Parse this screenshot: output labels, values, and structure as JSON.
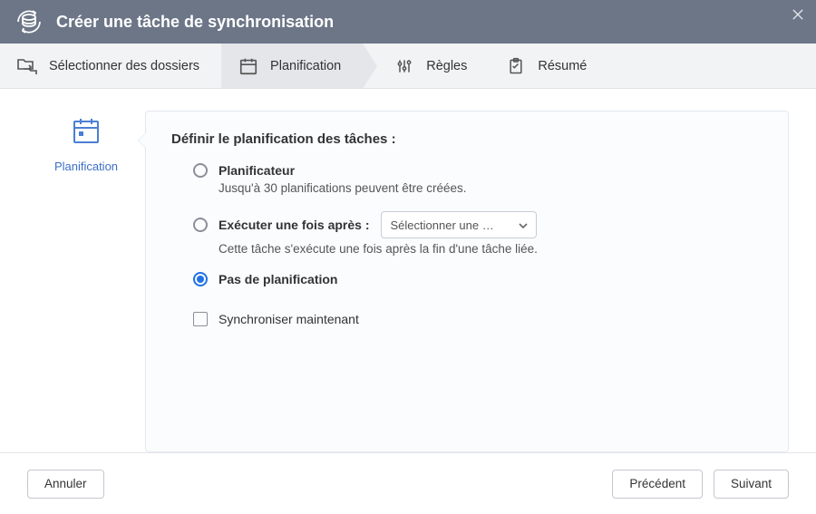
{
  "header": {
    "title": "Créer une tâche de synchronisation"
  },
  "steps": {
    "select_folders": "Sélectionner des dossiers",
    "schedule": "Planification",
    "rules": "Règles",
    "summary": "Résumé"
  },
  "sidebar": {
    "label": "Planification"
  },
  "panel": {
    "heading": "Définir le planification des tâches :",
    "scheduler": {
      "label": "Planificateur",
      "desc": "Jusqu'à 30 planifications peuvent être créées."
    },
    "run_after": {
      "label": "Exécuter une fois après :",
      "select_placeholder": "Sélectionner une …",
      "desc": "Cette tâche s'exécute une fois après la fin d'une tâche liée."
    },
    "no_schedule": {
      "label": "Pas de planification"
    },
    "sync_now": {
      "label": "Synchroniser maintenant"
    }
  },
  "footer": {
    "cancel": "Annuler",
    "previous": "Précédent",
    "next": "Suivant"
  }
}
